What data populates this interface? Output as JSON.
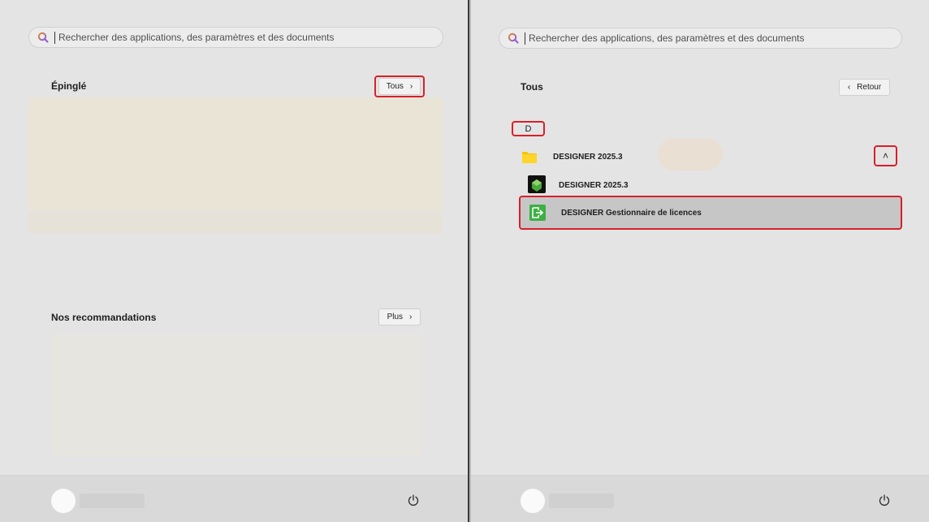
{
  "search": {
    "placeholder": "Rechercher des applications, des paramètres et des documents"
  },
  "left": {
    "pinned_title": "Épinglé",
    "all_button": "Tous",
    "recommended_title": "Nos recommandations",
    "more_button": "Plus"
  },
  "right": {
    "all_title": "Tous",
    "back_button": "Retour",
    "letter": "D",
    "folder_label": "DESIGNER 2025.3",
    "app1_label": "DESIGNER 2025.3",
    "app2_label": "DESIGNER Gestionnaire de licences"
  },
  "icons": {
    "chevron_right": "›",
    "chevron_left": "‹",
    "chevron_up": "˄"
  },
  "colors": {
    "highlight": "#d7202b",
    "folder": "#f5c400",
    "license_app": "#3cb043"
  }
}
